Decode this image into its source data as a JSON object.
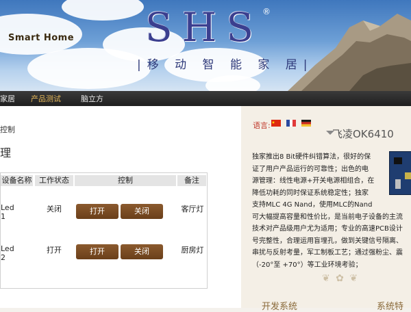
{
  "header": {
    "brand_en": "Smart  Home",
    "logo": "SHS",
    "registered": "®",
    "logo_subtitle": "|移 动 智 能 家 居|"
  },
  "nav": {
    "items": [
      {
        "label": "家居",
        "active": false
      },
      {
        "label": "产品测试",
        "active": true
      },
      {
        "label": "脑立方",
        "active": false
      }
    ]
  },
  "main": {
    "breadcrumb": "控制",
    "section_title": "理",
    "table": {
      "headers": [
        "设备名称",
        "工作状态",
        "控制",
        "备注"
      ],
      "rows": [
        {
          "name": "Led 1",
          "status": "关闭",
          "on_label": "打开",
          "off_label": "关闭",
          "note": "客厅灯"
        },
        {
          "name": "Led 2",
          "status": "打开",
          "on_label": "打开",
          "off_label": "关闭",
          "note": "厨房灯"
        }
      ]
    }
  },
  "sidebar": {
    "language_label": "语言:",
    "flags": [
      "china-flag-icon",
      "france-flag-icon",
      "germany-flag-icon"
    ],
    "product_title": "飞凌OK6410",
    "description_lines": [
      "独家推出8  Bit硬件纠错算法，很好的保",
      "证了用户产品运行的可靠性；出色的电",
      "源管理：线性电源+开关电源相组合，在",
      "降低功耗的同时保证系统稳定性；独家",
      "支持MLC 4G Nand，使用MLC的Nand",
      "可大幅提高容量和性价比，是当前电子设备的主流",
      "技术对产品级用户尤为适用；专业的高速PCB设计",
      "号完整性，合理运用盲埋孔，做到关键信号隔离、",
      "串扰与反射考量，军工制板工艺；通过强粉尘、震",
      "（-20°至 +70°）等工业环境考验；"
    ],
    "footer_headings": [
      "开发系统",
      "系统特"
    ]
  },
  "colors": {
    "button_brown": "#7a4b22",
    "nav_active": "#e7b95a",
    "language_red": "#c0392b"
  }
}
